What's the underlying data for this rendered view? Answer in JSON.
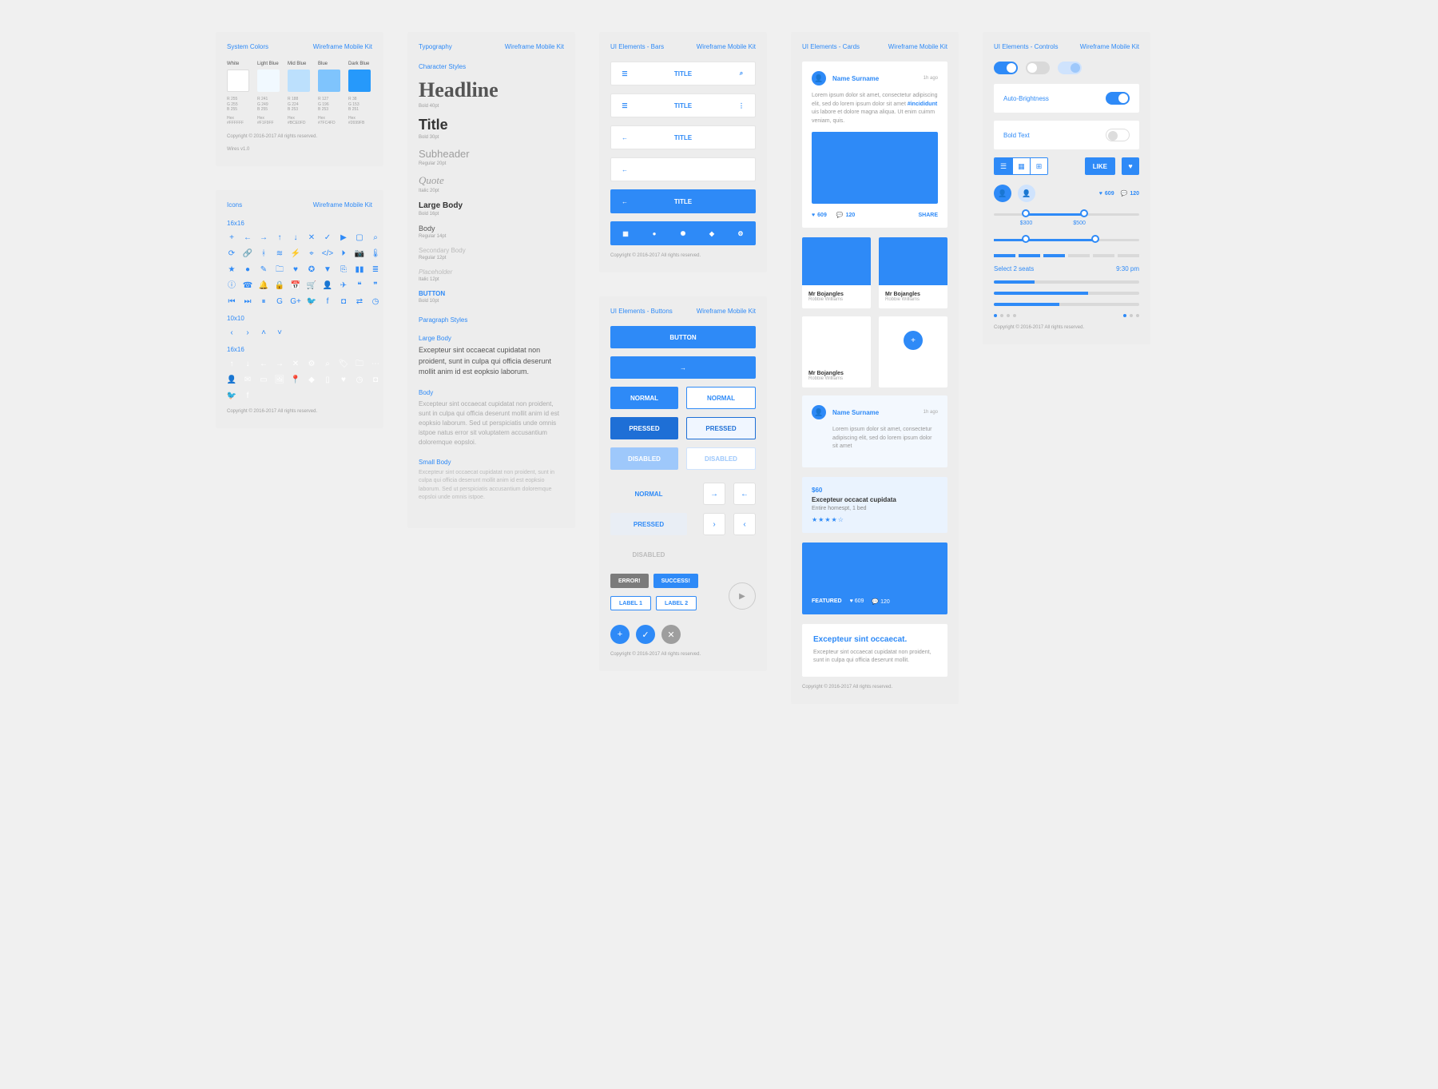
{
  "kit": "Wireframe Mobile Kit",
  "footer": "Copyright © 2016-2017 All rights reserved.",
  "colors": {
    "title": "System Colors",
    "swatches": [
      {
        "name": "White",
        "hex": "#FFFFFF",
        "rgb": [
          "R 255",
          "G 255",
          "B 255"
        ],
        "hexlabel": "Hex",
        "hexval": "#FFFFFF"
      },
      {
        "name": "Light Blue",
        "hex": "#F1F9FF",
        "rgb": [
          "R 241",
          "G 249",
          "B 255"
        ],
        "hexlabel": "Hex",
        "hexval": "#F1F9FF"
      },
      {
        "name": "Mid Blue",
        "hex": "#BCE0FD",
        "rgb": [
          "R 188",
          "G 224",
          "B 253"
        ],
        "hexlabel": "Hex",
        "hexval": "#BCE0FD"
      },
      {
        "name": "Blue",
        "hex": "#7FC4FD",
        "rgb": [
          "R 127",
          "G 196",
          "B 253"
        ],
        "hexlabel": "Hex",
        "hexval": "#7FC4FD"
      },
      {
        "name": "Dark Blue",
        "hex": "#2699FB",
        "rgb": [
          "R 38",
          "G 153",
          "B 251"
        ],
        "hexlabel": "Hex",
        "hexval": "#2699FB"
      }
    ],
    "version": "Wires v1.0"
  },
  "icons": {
    "title": "Icons",
    "size16": "16x16",
    "size10": "10x10",
    "size16b": "16x16",
    "set_a": [
      "plus",
      "arrow-left",
      "arrow-right",
      "arrow-up",
      "arrow-down",
      "close",
      "check",
      "play",
      "box",
      "search",
      "refresh",
      "link",
      "bluetooth",
      "wifi",
      "bolt",
      "location",
      "code",
      "video",
      "camera",
      "thermo",
      "star",
      "dot",
      "pencil",
      "folder",
      "heart",
      "compass",
      "down-tri",
      "bookmark",
      "chart",
      "columns",
      "info",
      "phone",
      "bell",
      "lock",
      "calendar",
      "cart",
      "user",
      "plane",
      "quote-l",
      "quote-r",
      "skip-back",
      "skip-fwd",
      "pause",
      "google",
      "gplus",
      "twitter",
      "facebook",
      "instagram",
      "shuffle",
      "clock"
    ],
    "set_b": [
      "chevron-left",
      "chevron-right",
      "chevron-up",
      "chevron-down"
    ],
    "set_c": [
      "arrow-up",
      "arrow-down",
      "arrow-left",
      "arrow-right",
      "close",
      "settings",
      "search",
      "tag",
      "folder",
      "more",
      "user",
      "mail",
      "card",
      "image",
      "pin",
      "apple",
      "tablet",
      "heart",
      "clock",
      "instagram",
      "twitter",
      "facebook"
    ]
  },
  "typo": {
    "title": "Typography",
    "char_label": "Character Styles",
    "items": [
      {
        "k": "headline",
        "text": "Headline",
        "meta": "Bold 40pt"
      },
      {
        "k": "title",
        "text": "Title",
        "meta": "Bold 30pt"
      },
      {
        "k": "subheader",
        "text": "Subheader",
        "meta": "Regular 20pt"
      },
      {
        "k": "quote",
        "text": "Quote",
        "meta": "Italic 20pt"
      },
      {
        "k": "lgbody",
        "text": "Large Body",
        "meta": "Bold 16pt"
      },
      {
        "k": "body",
        "text": "Body",
        "meta": "Regular 14pt"
      },
      {
        "k": "secbody",
        "text": "Secondary Body",
        "meta": "Regular 12pt"
      },
      {
        "k": "placeholder",
        "text": "Placeholder",
        "meta": "Italic 12pt"
      },
      {
        "k": "btn",
        "text": "BUTTON",
        "meta": "Bold 10pt"
      }
    ],
    "para_label": "Paragraph Styles",
    "large_body_label": "Large Body",
    "large_body_text": "Excepteur sint occaecat cupidatat non proident, sunt in culpa qui officia deserunt mollit anim id est eopksio laborum.",
    "body_label": "Body",
    "body_text": "Excepteur sint occaecat cupidatat non proident, sunt in culpa qui officia deserunt mollit anim id est eopksio laborum. Sed ut perspiciatis unde omnis istpoe natus error sit voluptatem accusantium doloremque eopsloi.",
    "small_label": "Small Body",
    "small_text": "Excepteur sint occaecat cupidatat non proident, sunt in culpa qui officia deserunt mollit anim id est eopksio laborum. Sed ut perspiciatis accusantium doloremque eopsloi unde omnis istpoe."
  },
  "bars": {
    "title": "UI Elements - Bars",
    "label": "TITLE"
  },
  "buttons": {
    "title": "UI Elements - Buttons",
    "button": "BUTTON",
    "normal": "NORMAL",
    "pressed": "PRESSED",
    "disabled": "DISABLED",
    "error": "ERROR!",
    "success": "SUCCESS!",
    "label1": "LABEL 1",
    "label2": "LABEL 2"
  },
  "cards": {
    "title": "UI Elements - Cards",
    "name": "Name Surname",
    "time": "1h ago",
    "lorem": "Lorem ipsum dolor sit amet, consectetur adipiscing elit, sed do lorem ipsum dolor sit amet",
    "hash": "#incididunt",
    "lorem2": "uis labore et dolore magna aliqua. Ut enim cuimm veniam, quis.",
    "likes": "609",
    "comments": "120",
    "share": "SHARE",
    "mr": "Mr Bojangles",
    "robbie": "Robbie Williams",
    "price": "$60",
    "excp": "Excepteur occacat cupidata",
    "hotel": "Entire homespt, 1 bed",
    "featured": "FEATURED",
    "cta_title": "Excepteur sint occaecat.",
    "cta_body": "Excepteur sint occaecat cupidatat non proident, sunt in culpa qui officia deserunt mollit."
  },
  "controls": {
    "title": "UI Elements - Controls",
    "auto": "Auto-Brightness",
    "bold": "Bold Text",
    "like": "LIKE",
    "likes": "609",
    "comments": "120",
    "p300": "$300",
    "p500": "$500",
    "seats": "Select 2 seats",
    "time": "9:30 pm"
  }
}
